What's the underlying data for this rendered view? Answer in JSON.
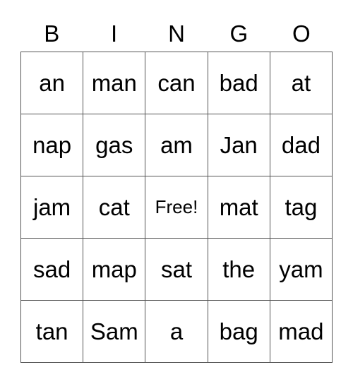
{
  "card": {
    "header": [
      "B",
      "I",
      "N",
      "G",
      "O"
    ],
    "rows": [
      [
        "an",
        "man",
        "can",
        "bad",
        "at"
      ],
      [
        "nap",
        "gas",
        "am",
        "Jan",
        "dad"
      ],
      [
        "jam",
        "cat",
        "Free!",
        "mat",
        "tag"
      ],
      [
        "sad",
        "map",
        "sat",
        "the",
        "yam"
      ],
      [
        "tan",
        "Sam",
        "a",
        "bag",
        "mad"
      ]
    ],
    "free_space": {
      "row": 2,
      "col": 2
    }
  },
  "colors": {
    "border": "#555555",
    "text": "#000000",
    "background": "#ffffff"
  }
}
